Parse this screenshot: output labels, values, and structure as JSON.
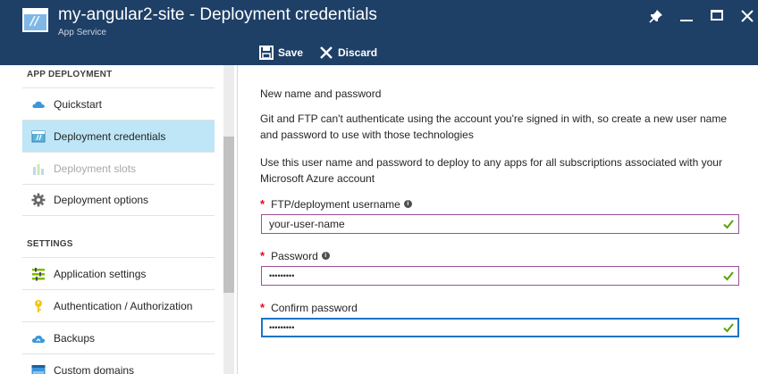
{
  "header": {
    "title": "my-angular2-site - Deployment credentials",
    "subtitle": "App Service",
    "bg_color": "#1e3f66",
    "icons": [
      "app-service-icon",
      "pin-icon",
      "minimize-icon",
      "maximize-icon",
      "close-icon"
    ],
    "commands": {
      "save_label": "Save",
      "discard_label": "Discard"
    }
  },
  "menu": {
    "sections": [
      {
        "title": "APP DEPLOYMENT",
        "items": [
          {
            "label": "Quickstart",
            "icon": "cloud-icon",
            "state": "normal"
          },
          {
            "label": "Deployment credentials",
            "icon": "credentials-icon",
            "state": "selected"
          },
          {
            "label": "Deployment slots",
            "icon": "slots-icon",
            "state": "disabled"
          },
          {
            "label": "Deployment options",
            "icon": "gear-icon",
            "state": "normal"
          }
        ]
      },
      {
        "title": "SETTINGS",
        "items": [
          {
            "label": "Application settings",
            "icon": "settings-list-icon",
            "state": "normal"
          },
          {
            "label": "Authentication / Authorization",
            "icon": "key-icon",
            "state": "normal"
          },
          {
            "label": "Backups",
            "icon": "backup-cloud-icon",
            "state": "normal"
          },
          {
            "label": "Custom domains",
            "icon": "www-icon",
            "state": "normal"
          }
        ]
      }
    ],
    "selected_color": "#bee6f7"
  },
  "form": {
    "heading": "New name and password",
    "paragraph1": "Git and FTP can't authenticate using the account you're signed in with, so create a new user name and password to use with those technologies",
    "paragraph2": "Use this user name and password to deploy to any apps for all subscriptions associated with your Microsoft Azure account",
    "required_marker": "*",
    "fields": [
      {
        "label": "FTP/deployment username",
        "value": "your-user-name",
        "info": true,
        "valid": true
      },
      {
        "label": "Password",
        "value": "•••••••••",
        "info": true,
        "valid": true
      },
      {
        "label": "Confirm password",
        "value": "•••••••••",
        "info": false,
        "valid": true,
        "focused": true
      }
    ],
    "colors": {
      "required": "#e00b1c",
      "valid_check": "#57a300",
      "field_border": "#9e4e9a",
      "focus_border": "#1a73c6"
    }
  }
}
